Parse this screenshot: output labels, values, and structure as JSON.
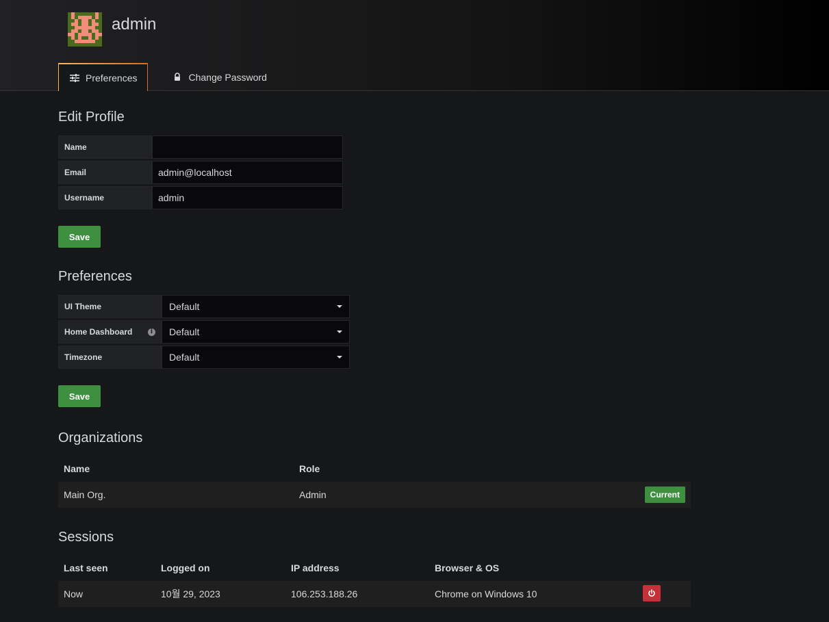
{
  "header": {
    "title": "admin",
    "tabs": [
      {
        "label": "Preferences",
        "icon": "sliders-icon",
        "active": true
      },
      {
        "label": "Change Password",
        "icon": "lock-icon",
        "active": false
      }
    ]
  },
  "edit_profile": {
    "title": "Edit Profile",
    "fields": {
      "name": {
        "label": "Name",
        "value": ""
      },
      "email": {
        "label": "Email",
        "value": "admin@localhost"
      },
      "username": {
        "label": "Username",
        "value": "admin"
      }
    },
    "save_label": "Save"
  },
  "preferences": {
    "title": "Preferences",
    "ui_theme": {
      "label": "UI Theme",
      "value": "Default"
    },
    "home_dashboard": {
      "label": "Home Dashboard",
      "value": "Default",
      "info_icon": "info-icon"
    },
    "timezone": {
      "label": "Timezone",
      "value": "Default"
    },
    "save_label": "Save"
  },
  "organizations": {
    "title": "Organizations",
    "columns": [
      "Name",
      "Role"
    ],
    "rows": [
      {
        "name": "Main Org.",
        "role": "Admin",
        "badge": "Current"
      }
    ]
  },
  "sessions": {
    "title": "Sessions",
    "columns": [
      "Last seen",
      "Logged on",
      "IP address",
      "Browser & OS"
    ],
    "rows": [
      {
        "last_seen": "Now",
        "logged_on": "10월 29, 2023",
        "ip": "106.253.188.26",
        "browser": "Chrome on Windows 10",
        "action_icon": "power-icon"
      }
    ]
  },
  "colors": {
    "accent_green": "#3f8f40",
    "danger_red": "#c4313b",
    "tab_gradient_start": "#ffb357",
    "tab_gradient_end": "#e06d14"
  }
}
